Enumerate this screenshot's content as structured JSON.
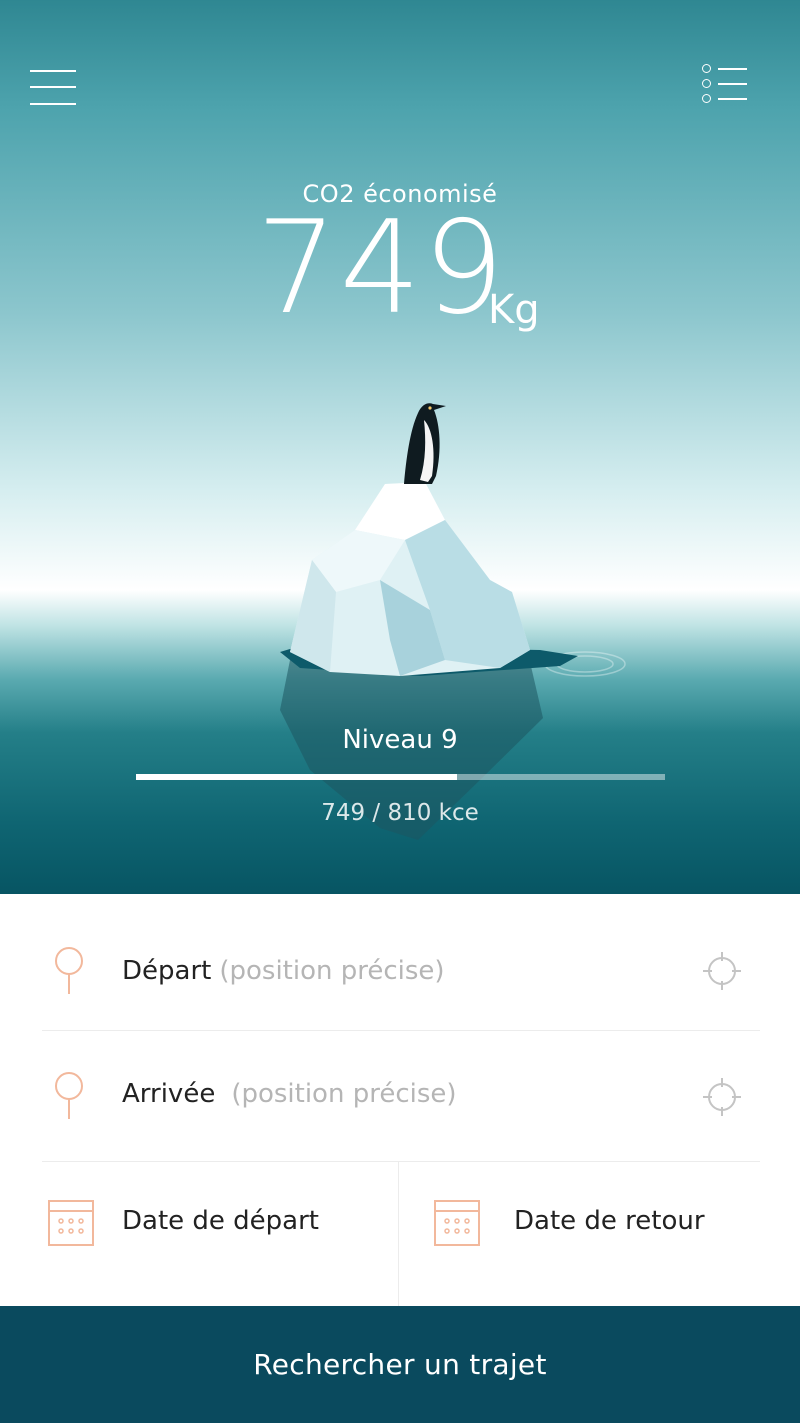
{
  "header": {
    "menu_icon": "hamburger-menu-icon",
    "list_icon": "list-view-icon"
  },
  "stats": {
    "co2_label": "CO2 économisé",
    "co2_value": "749",
    "co2_unit": "Kg"
  },
  "level": {
    "label": "Niveau 9",
    "progress_text": "749 / 810 kce",
    "current": 749,
    "target": 810,
    "progress_fraction": 0.606
  },
  "form": {
    "depart": {
      "label": "Départ",
      "hint": "(position précise)"
    },
    "arrivee": {
      "label": "Arrivée",
      "hint": "(position précise)"
    },
    "date_depart_label": "Date de départ",
    "date_retour_label": "Date de retour"
  },
  "search_button": {
    "label": "Rechercher un trajet"
  },
  "colors": {
    "accent_orange": "#f2b89c",
    "button_bg": "#0a4a5e",
    "crosshair_gray": "#c4c4c4"
  }
}
